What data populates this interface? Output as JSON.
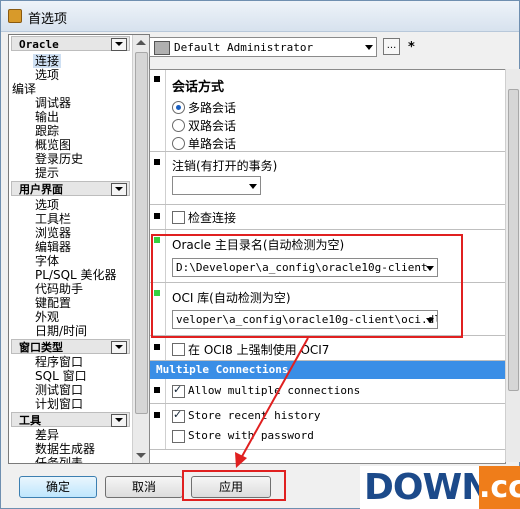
{
  "window": {
    "title": "首选项"
  },
  "sidebar": {
    "groups": [
      {
        "label": "Oracle"
      },
      {
        "label": "用户界面"
      },
      {
        "label": "窗口类型"
      },
      {
        "label": "工具"
      }
    ],
    "oracle_items": [
      "连接",
      "选项"
    ],
    "edit_category": "编译",
    "edit_items": [
      "调试器",
      "输出",
      "跟踪",
      "概览图",
      "登录历史",
      "提示"
    ],
    "ui_items": [
      "选项",
      "工具栏",
      "浏览器",
      "编辑器",
      "字体",
      "PL/SQL 美化器",
      "代码助手",
      "键配置",
      "外观",
      "日期/时间"
    ],
    "window_items": [
      "程序窗口",
      "SQL 窗口",
      "测试窗口",
      "计划窗口"
    ],
    "tool_items": [
      "差异",
      "数据生成器",
      "任务列表"
    ]
  },
  "profile": {
    "value": "Default Administrator",
    "more_label": "...",
    "star": "*"
  },
  "settings": {
    "session_mode": {
      "title": "会话方式",
      "options": [
        {
          "label": "多路会话",
          "selected": true
        },
        {
          "label": "双路会话",
          "selected": false
        },
        {
          "label": "单路会话",
          "selected": false
        }
      ]
    },
    "logoff": {
      "title": "注销(有打开的事务)",
      "value": ""
    },
    "check_connection": {
      "label": "检查连接",
      "checked": false
    },
    "oracle_home": {
      "title": "Oracle 主目录名(自动检测为空)",
      "value": "D:\\Developer\\a_config\\oracle10g-client"
    },
    "oci_library": {
      "title": "OCI 库(自动检测为空)",
      "value": "veloper\\a_config\\oracle10g-client\\oci.dll"
    },
    "force_oci7": {
      "label": "在 OCI8 上强制使用 OCI7",
      "checked": false
    },
    "multiple_connections": {
      "header": "Multiple Connections",
      "allow": {
        "label": "Allow multiple connections",
        "checked": true
      }
    },
    "history": {
      "store_recent": {
        "label": "Store recent history",
        "checked": true
      },
      "store_password": {
        "label": "Store with password",
        "checked": false
      }
    }
  },
  "buttons": {
    "ok": "确定",
    "cancel": "取消",
    "apply": "应用"
  },
  "watermark": {
    "main": "DOWN",
    "suffix": ".cc"
  },
  "colors": {
    "accent": "#3a8ee6",
    "highlight_box": "#e02020",
    "changed_marker": "#34d040"
  }
}
